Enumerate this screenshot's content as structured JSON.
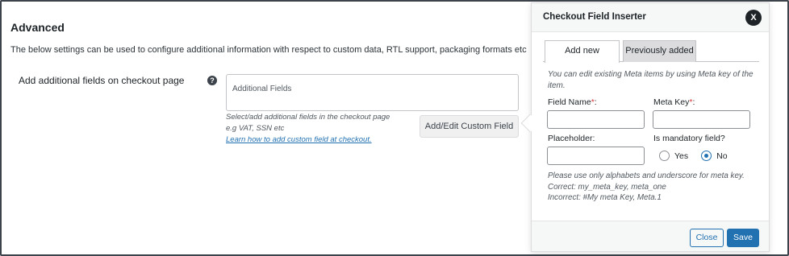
{
  "section": {
    "title": "Advanced",
    "description": "The below settings can be used to configure additional information with respect to custom data, RTL support, packaging formats etc"
  },
  "setting": {
    "label": "Add additional fields on checkout page",
    "help_icon": "?",
    "fields_placeholder": "Additional Fields",
    "help_line1": "Select/add additional fields in the checkout page",
    "help_line2": "e.g VAT, SSN etc",
    "help_link": "Learn how to add custom field at checkout.",
    "add_edit_button": "Add/Edit Custom Field"
  },
  "popup": {
    "title": "Checkout Field Inserter",
    "close_icon": "X",
    "tabs": [
      {
        "label": "Add new",
        "active": true
      },
      {
        "label": "Previously added",
        "active": false
      }
    ],
    "info": "You can edit existing Meta items by using Meta key of the item.",
    "field_name_label": "Field Name",
    "meta_key_label": "Meta Key",
    "required_mark": "*",
    "label_suffix": ":",
    "placeholder_label": "Placeholder:",
    "mandatory_label": "Is mandatory field?",
    "mandatory_options": {
      "yes": "Yes",
      "no": "No",
      "selected": "No"
    },
    "note_line1": "Please use only alphabets and underscore for meta key.",
    "note_line2": "Correct: my_meta_key, meta_one",
    "note_line3": "Incorrect: #My meta Key, Meta.1",
    "close_button": "Close",
    "save_button": "Save"
  },
  "colors": {
    "accent": "#2271b1",
    "required": "#d63638"
  }
}
